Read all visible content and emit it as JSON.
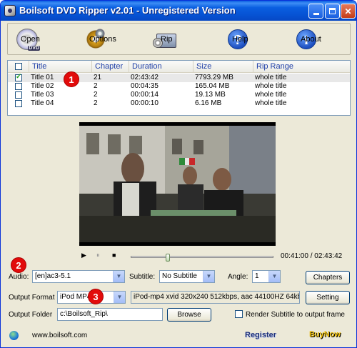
{
  "window": {
    "title": "Boilsoft DVD Ripper v2.01 - Unregistered Version"
  },
  "toolbar": {
    "open": {
      "label": "Open",
      "icon": "dvd-disc-icon"
    },
    "options": {
      "label": "Options",
      "icon": "gears-icon"
    },
    "rip": {
      "label": "Rip",
      "icon": "rip-monitor-icon"
    },
    "help": {
      "label": "Help",
      "icon": "help-icon"
    },
    "about": {
      "label": "About",
      "icon": "info-icon"
    }
  },
  "titles": {
    "headers": {
      "title": "Title",
      "chapter": "Chapter",
      "duration": "Duration",
      "size": "Size",
      "rip_range": "Rip Range"
    },
    "rows": [
      {
        "checked": true,
        "title": "Title 01",
        "chapter": "21",
        "duration": "02:43:42",
        "size": "7793.29 MB",
        "rip_range": "whole title"
      },
      {
        "checked": false,
        "title": "Title 02",
        "chapter": "2",
        "duration": "00:04:35",
        "size": "165.04 MB",
        "rip_range": "whole title"
      },
      {
        "checked": false,
        "title": "Title 03",
        "chapter": "2",
        "duration": "00:00:14",
        "size": "19.13 MB",
        "rip_range": "whole title"
      },
      {
        "checked": false,
        "title": "Title 04",
        "chapter": "2",
        "duration": "00:00:10",
        "size": "6.16 MB",
        "rip_range": "whole title"
      }
    ]
  },
  "badges": {
    "one": "1",
    "two": "2",
    "three": "3"
  },
  "player": {
    "play": "▶",
    "pause": "⏸",
    "stop": "■",
    "time": "00:41:00 / 02:43:42",
    "progress": 0.25
  },
  "audio": {
    "label": "Audio:",
    "value": "[en]ac3-5.1"
  },
  "subtitle": {
    "label": "Subtitle:",
    "value": "No Subtitle"
  },
  "angle": {
    "label": "Angle:",
    "value": "1"
  },
  "chapters_button": "Chapters",
  "output_format": {
    "label": "Output Format",
    "value": "iPod MP4",
    "details": "iPod-mp4 xvid 320x240 512kbps, aac 44100HZ 64kbps"
  },
  "setting_button": "Setting",
  "output_folder": {
    "label": "Output Folder",
    "value": "c:\\Boilsoft_Rip\\"
  },
  "browse_button": "Browse",
  "render_subtitle": {
    "label": "Render Subtitle to output frame",
    "checked": false
  },
  "footer": {
    "website": "www.boilsoft.com",
    "register": "Register",
    "buynow": "BuyNow"
  },
  "colors": {
    "accent": "#0a5ee0",
    "badge": "#e20b0b",
    "link": "#1f3fa8"
  }
}
